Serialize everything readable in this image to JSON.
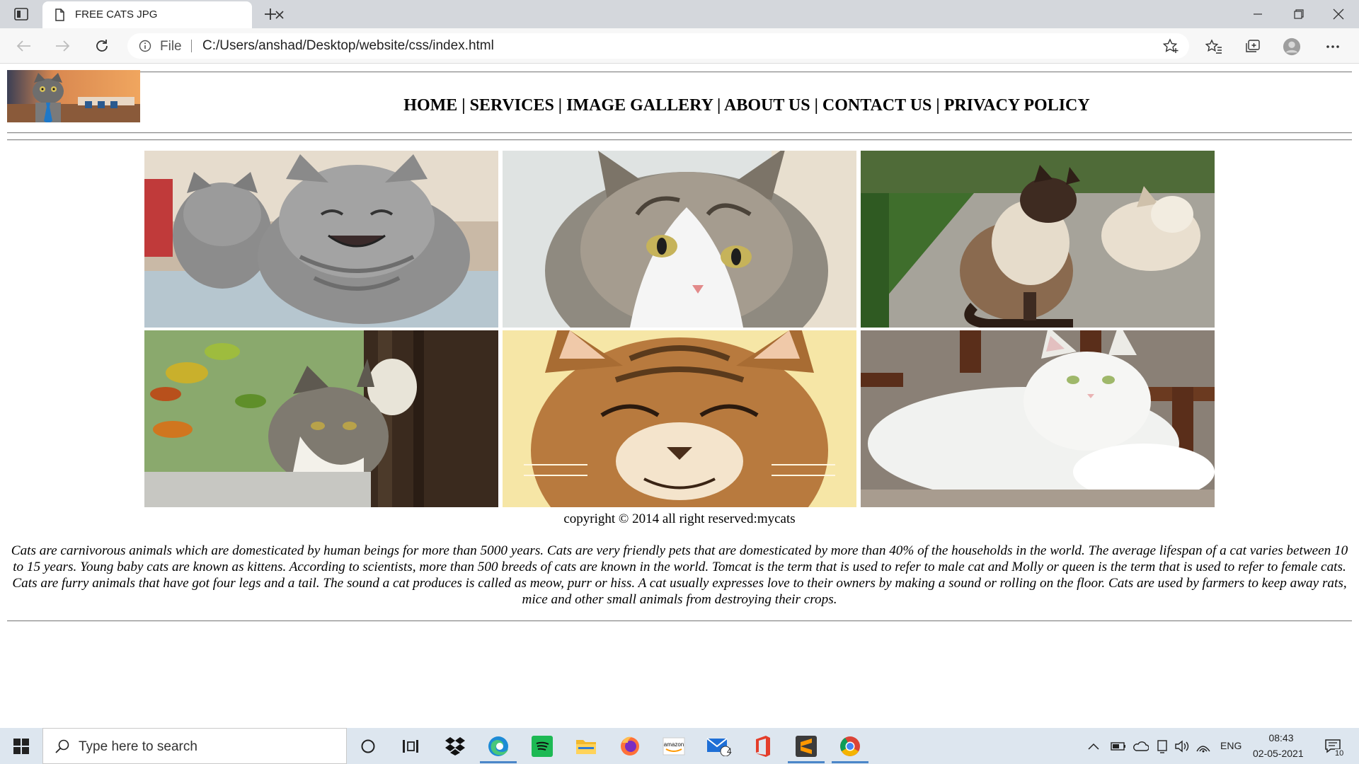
{
  "browser": {
    "tab_title": "FREE CATS JPG",
    "file_label": "File",
    "url": "C:/Users/anshad/Desktop/website/css/index.html"
  },
  "site": {
    "nav": [
      {
        "label": "HOME"
      },
      {
        "label": "SERVICES"
      },
      {
        "label": "IMAGE GALLERY"
      },
      {
        "label": "ABOUT US"
      },
      {
        "label": "CONTACT US"
      },
      {
        "label": "PRIVACY POLICY"
      }
    ],
    "nav_separator": " | ",
    "gallery": [
      {
        "icon": "laughing-kittens-photo"
      },
      {
        "icon": "tabby-white-cat-face-photo"
      },
      {
        "icon": "siamese-cats-photo"
      },
      {
        "icon": "tabby-cat-behind-tree-photo"
      },
      {
        "icon": "smiling-kitten-photo"
      },
      {
        "icon": "white-fluffy-cat-photo"
      }
    ],
    "copyright": "copyright © 2014 all right reserved:mycats",
    "paragraph": "Cats are carnivorous animals which are domesticated by human beings for more than 5000 years. Cats are very friendly pets that are domesticated by more than 40% of the households in the world. The average lifespan of a cat varies between 10 to 15 years. Young baby cats are known as kittens. According to scientists, more than 500 breeds of cats are known in the world. Tomcat is the term that is used to refer to male cat and Molly or queen is the term that is used to refer to female cats. Cats are furry animals that have got four legs and a tail. The sound a cat produces is called as meow, purr or hiss. A cat usually expresses love to their owners by making a sound or rolling on the floor. Cats are used by farmers to keep away rats, mice and other small animals from destroying their crops."
  },
  "taskbar": {
    "search_placeholder": "Type here to search",
    "mail_badge": "4",
    "language": "ENG",
    "time": "08:43",
    "date": "02-05-2021",
    "notification_count": "10"
  },
  "colors": {
    "tabbar_bg": "#d4d7dc",
    "taskbar_bg": "#dde6ef",
    "accent": "#4a86c8"
  }
}
